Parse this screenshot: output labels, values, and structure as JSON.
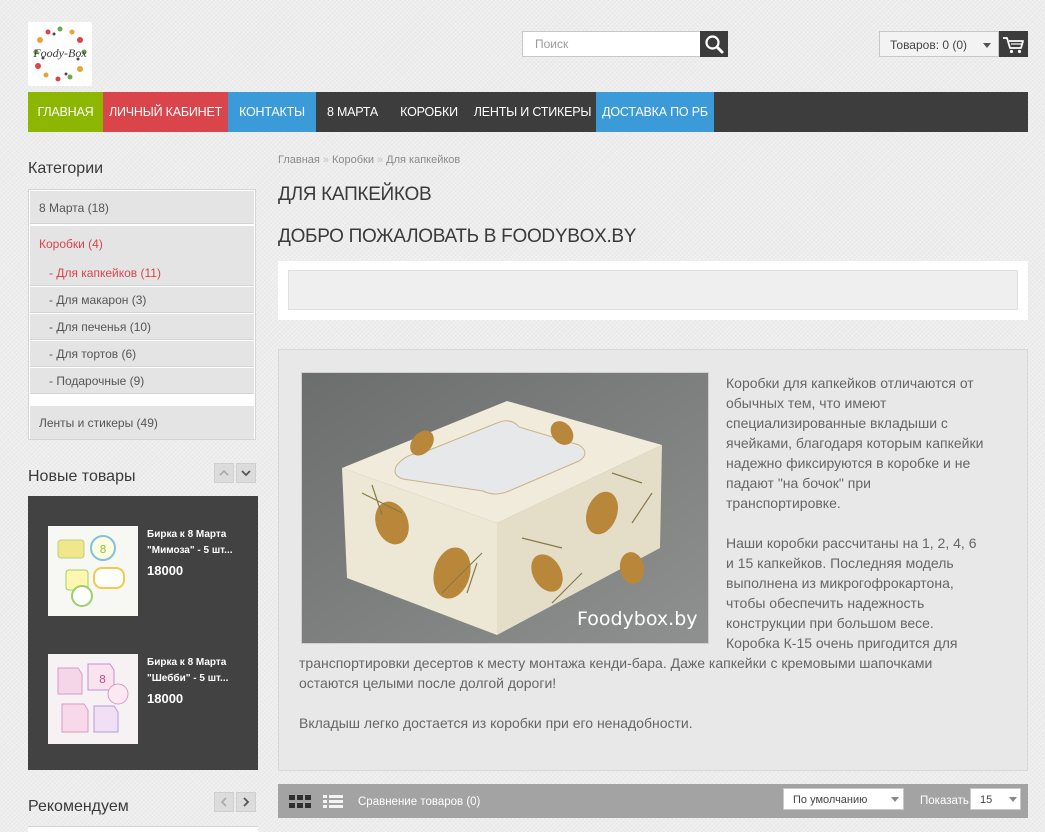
{
  "header": {
    "logo_text": "Foody-Box",
    "search_placeholder": "Поиск",
    "cart_label": "Товаров: 0 (0)"
  },
  "nav": [
    {
      "label": "ГЛАВНАЯ",
      "color": "#8db600"
    },
    {
      "label": "ЛИЧНЫЙ КАБИНЕТ",
      "color": "#d9454a"
    },
    {
      "label": "КОНТАКТЫ",
      "color": "#3b9bd9"
    },
    {
      "label": "8 МАРТА",
      "color": "#3d3d3d"
    },
    {
      "label": "КОРОБКИ",
      "color": "#3d3d3d"
    },
    {
      "label": "ЛЕНТЫ И СТИКЕРЫ",
      "color": "#3d3d3d"
    },
    {
      "label": "ДОСТАВКА ПО РБ",
      "color": "#3b9bd9"
    }
  ],
  "sidebar": {
    "categories_title": "Категории",
    "categories": [
      {
        "label": "8 Марта (18)"
      },
      {
        "label": "Коробки (4)",
        "active": true
      },
      {
        "label": "Ленты и стикеры (49)"
      }
    ],
    "subcategories": [
      {
        "label": "- Для капкейков (11)",
        "active": true
      },
      {
        "label": "- Для макарон (3)"
      },
      {
        "label": "- Для печенья (10)"
      },
      {
        "label": "- Для тортов (6)"
      },
      {
        "label": "- Подарочные (9)"
      }
    ],
    "new_title": "Новые товары",
    "new_products": [
      {
        "name": "Бирка к 8 Марта \"Мимоза\" - 5 шт...",
        "price": "18000"
      },
      {
        "name": "Бирка к 8 Марта \"Шебби\" - 5 шт...",
        "price": "18000"
      }
    ],
    "recommend_title": "Рекомендуем"
  },
  "breadcrumb": [
    "Главная",
    "Коробки",
    "Для капкейков"
  ],
  "page_title": "ДЛЯ КАПКЕЙКОВ",
  "welcome_title": "ДОБРО ПОЖАЛОВАТЬ В FOODYBOX.BY",
  "photo_watermark": "Foodybox.by",
  "description": {
    "p1": [
      "Коробки для капкейков отличаются от",
      "обычных тем, что имеют",
      "специализированные вкладыши с",
      "ячейками, благодаря которым капкейки",
      "надежно фиксируются в коробке и не",
      "падают \"на бочок\" при",
      "транспортировке."
    ],
    "p2": [
      "Наши коробки рассчитаны на 1, 2, 4, 6",
      "и 15 капкейков. Последняя модель",
      "выполнена из микрогофрокартона,",
      "чтобы обеспечить надежность",
      "конструкции при большом весе.",
      "Коробка К-15 очень пригодится для"
    ],
    "p2_tail": [
      "транспортировки десертов к месту монтажа кенди-бара. Даже капкейки с кремовыми шапочками",
      "остаются целыми после долгой дороги!"
    ],
    "p3": "Вкладыш легко достается из коробки при его ненадобности."
  },
  "toolbar": {
    "compare": "Сравнение товаров (0)",
    "sort": "По умолчанию",
    "show_label": "Показать:",
    "show_value": "15"
  }
}
